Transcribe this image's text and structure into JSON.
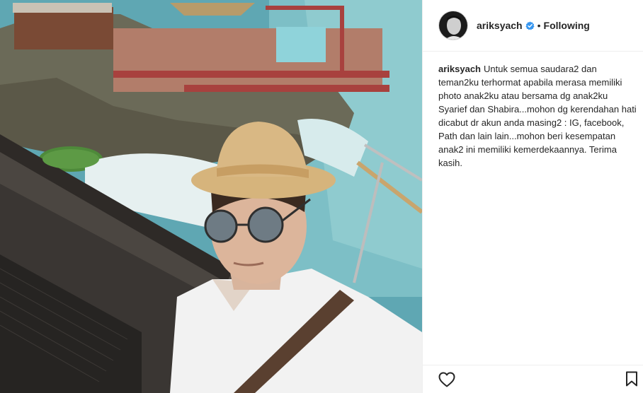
{
  "post": {
    "author": {
      "username": "ariksyach",
      "verified": true,
      "follow_status": "Following",
      "separator": "•"
    },
    "caption": {
      "username": "ariksyach",
      "text": "Untuk semua saudara2 dan teman2ku terhormat apabila merasa memiliki photo anak2ku atau bersama dg anak2ku Syarief dan Shabira...mohon dg kerendahan hati dicabut dr akun anda masing2 : IG, facebook, Path dan lain lain...mohon beri kesempatan anak2 ini memiliki kemerdekaannya. Terima kasih."
    },
    "actions": {
      "like_icon": "heart-icon",
      "save_icon": "bookmark-icon"
    },
    "colors": {
      "text": "#262626",
      "verified_badge": "#3897f0",
      "divider": "#efefef"
    }
  }
}
